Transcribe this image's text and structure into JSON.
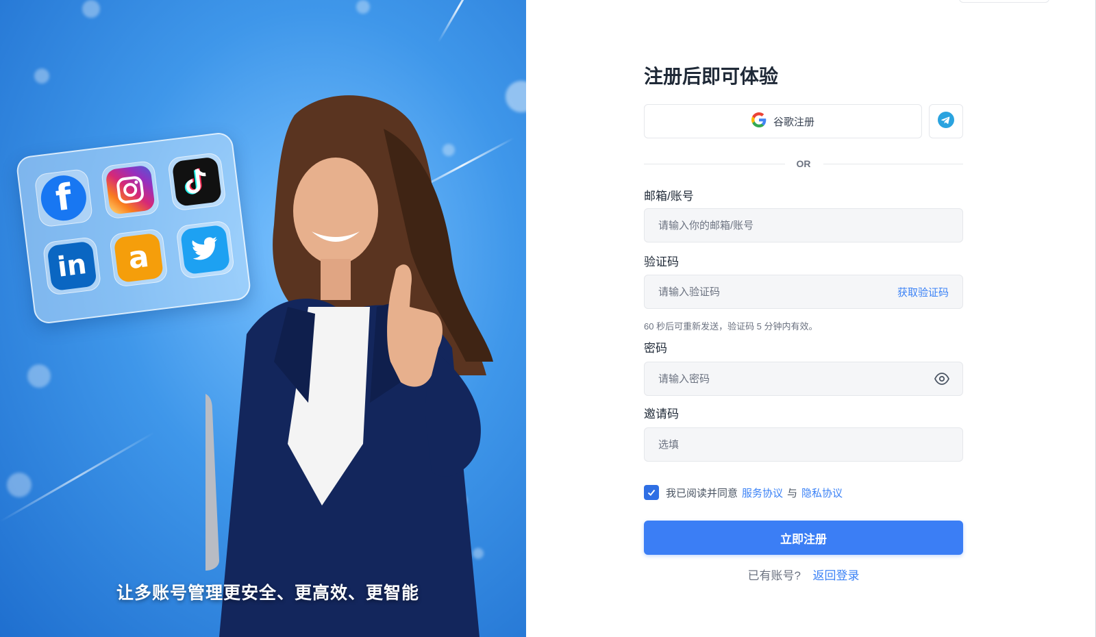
{
  "hero": {
    "tagline": "让多账号管理更安全、更高效、更智能",
    "social_icons": [
      "facebook-icon",
      "instagram-icon",
      "tiktok-icon",
      "linkedin-icon",
      "amazon-icon",
      "twitter-icon"
    ]
  },
  "form": {
    "title": "注册后即可体验",
    "google_label": "谷歌注册",
    "or_text": "OR",
    "email": {
      "label": "邮箱/账号",
      "placeholder": "请输入你的邮箱/账号"
    },
    "code": {
      "label": "验证码",
      "placeholder": "请输入验证码",
      "action": "获取验证码",
      "hint": "60 秒后可重新发送，验证码 5 分钟内有效。"
    },
    "password": {
      "label": "密码",
      "placeholder": "请输入密码"
    },
    "invite": {
      "label": "邀请码",
      "placeholder": "选填"
    },
    "agree": {
      "prefix": "我已阅读并同意",
      "terms": "服务协议",
      "and": "与",
      "privacy": "隐私协议",
      "checked": true
    },
    "submit_label": "立即注册",
    "footer": {
      "text": "已有账号?",
      "link": "返回登录"
    }
  },
  "colors": {
    "accent": "#3b7ef5",
    "link": "#3b82f6",
    "telegram": "#2aa3df"
  }
}
